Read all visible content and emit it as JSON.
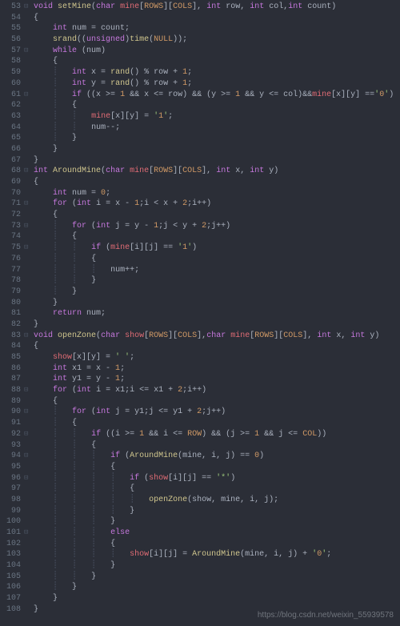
{
  "line_start": 53,
  "line_end": 108,
  "watermark": "https://blog.csdn.net/weixin_55939578",
  "code": {
    "l53": "void setMine(char mine[ROWS][COLS], int row, int col,int count)",
    "l54": "{",
    "l55": "    int num = count;",
    "l56": "    srand((unsigned)time(NULL));",
    "l57": "    while (num)",
    "l58": "    {",
    "l59": "        int x = rand() % row + 1;",
    "l60": "        int y = rand() % row + 1;",
    "l61": "        if ((x >= 1 && x <= row) && (y >= 1 && y <= col)&&mine[x][y] =='0')",
    "l62": "        {",
    "l63": "            mine[x][y] = '1';",
    "l64": "            num--;",
    "l65": "        }",
    "l66": "    }",
    "l67": "}",
    "l68": "int AroundMine(char mine[ROWS][COLS], int x, int y)",
    "l69": "{",
    "l70": "    int num = 0;",
    "l71": "    for (int i = x - 1;i < x + 2;i++)",
    "l72": "    {",
    "l73": "        for (int j = y - 1;j < y + 2;j++)",
    "l74": "        {",
    "l75": "            if (mine[i][j] == '1')",
    "l76": "            {",
    "l77": "                num++;",
    "l78": "            }",
    "l79": "        }",
    "l80": "    }",
    "l81": "    return num;",
    "l82": "}",
    "l83": "void openZone(char show[ROWS][COLS],char mine[ROWS][COLS], int x, int y)",
    "l84": "{",
    "l85": "    show[x][y] = ' ';",
    "l86": "    int x1 = x - 1;",
    "l87": "    int y1 = y - 1;",
    "l88": "    for (int i = x1;i <= x1 + 2;i++)",
    "l89": "    {",
    "l90": "        for (int j = y1;j <= y1 + 2;j++)",
    "l91": "        {",
    "l92": "            if ((i >= 1 && i <= ROW) && (j >= 1 && j <= COL))",
    "l93": "            {",
    "l94": "                if (AroundMine(mine, i, j) == 0)",
    "l95": "                {",
    "l96": "                    if (show[i][j] == '*')",
    "l97": "                    {",
    "l98": "                        openZone(show, mine, i, j);",
    "l99": "                    }",
    "l100": "                }",
    "l101": "                else",
    "l102": "                {",
    "l103": "                    show[i][j] = AroundMine(mine, i, j) + '0';",
    "l104": "                }",
    "l105": "            }",
    "l106": "        }",
    "l107": "    }",
    "l108": "}"
  },
  "fold_markers": {
    "53": "⊟",
    "57": "⊟",
    "61": "⊟",
    "68": "⊟",
    "71": "⊟",
    "73": "⊟",
    "75": "⊟",
    "83": "⊟",
    "88": "⊟",
    "90": "⊟",
    "92": "⊟",
    "94": "⊟",
    "96": "⊟",
    "101": "⊟"
  }
}
